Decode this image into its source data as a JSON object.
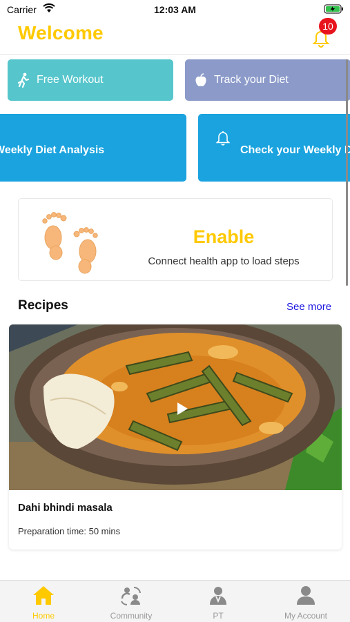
{
  "status_bar": {
    "carrier": "Carrier",
    "time": "12:03 AM"
  },
  "header": {
    "title": "Welcome",
    "notification_count": "10"
  },
  "tiles": {
    "free_workout": "Free Workout",
    "track_diet": "Track your Diet",
    "weekly_analysis": "Weekly Diet Analysis",
    "check_weekly": "Check your Weekly Diet"
  },
  "steps": {
    "enable": "Enable",
    "message": "Connect health app to load steps"
  },
  "recipes": {
    "title": "Recipes",
    "see_more": "See more",
    "items": [
      {
        "name": "Dahi bhindi masala",
        "prep_time": "Preparation time: 50 mins"
      }
    ]
  },
  "tabs": [
    {
      "label": "Home",
      "icon": "home-icon",
      "active": true
    },
    {
      "label": "Community",
      "icon": "community-icon",
      "active": false
    },
    {
      "label": "PT",
      "icon": "trainer-icon",
      "active": false
    },
    {
      "label": "My Account",
      "icon": "user-icon",
      "active": false
    }
  ],
  "colors": {
    "accent": "#ffc900",
    "free_workout_tile": "#56c6cc",
    "diet_tile": "#8b9ac9",
    "weekly_tile": "#1aa3df",
    "badge": "#e8141d",
    "link": "#1d17e0"
  }
}
